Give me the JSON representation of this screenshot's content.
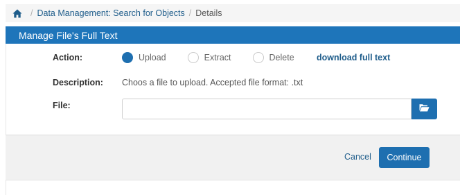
{
  "breadcrumb": {
    "home_icon": "home-icon",
    "separator": "/",
    "items": [
      {
        "label": "Data Management: Search for Objects"
      },
      {
        "label": "Details"
      }
    ]
  },
  "panel": {
    "title": "Manage File's Full Text",
    "header_color": "#1e75ba"
  },
  "form": {
    "action": {
      "label": "Action:",
      "options": [
        {
          "label": "Upload",
          "selected": true
        },
        {
          "label": "Extract",
          "selected": false
        },
        {
          "label": "Delete",
          "selected": false
        }
      ],
      "download_link": "download full text"
    },
    "description": {
      "label": "Description:",
      "text": "Choos a file to upload. Accepted file format: .txt"
    },
    "file": {
      "label": "File:",
      "value": "",
      "browse_icon": "folder-open-icon"
    }
  },
  "footer": {
    "cancel_label": "Cancel",
    "continue_label": "Continue"
  },
  "colors": {
    "accent": "#1e6fb0",
    "link": "#1f5d8b",
    "footer_bg": "#f1f1f1"
  }
}
